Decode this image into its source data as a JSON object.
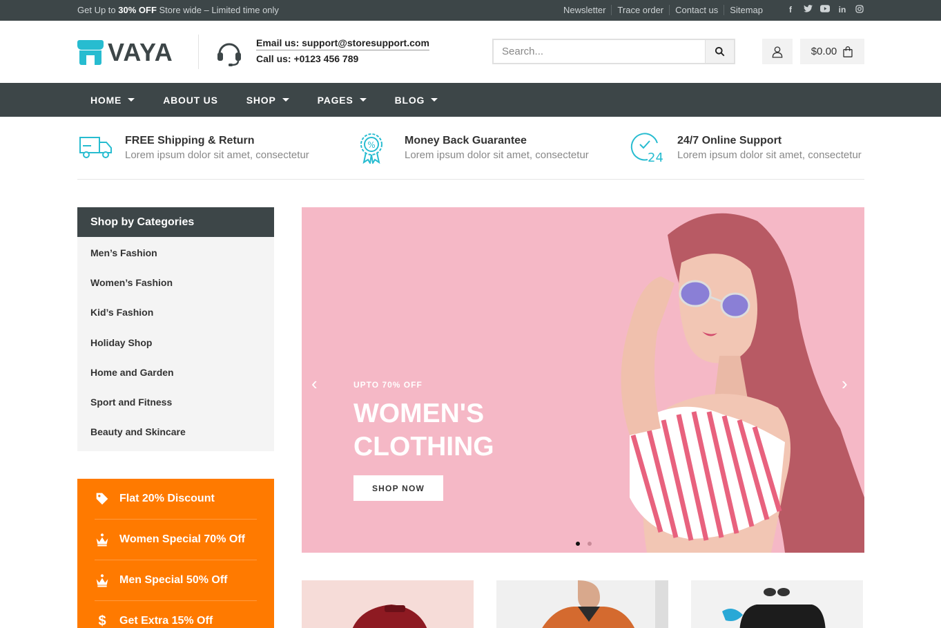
{
  "topbar": {
    "promo_prefix": "Get Up to",
    "promo_bold": "30% OFF",
    "promo_suffix": "Store wide – Limited time only",
    "links": [
      "Newsletter",
      "Trace order",
      "Contact us",
      "Sitemap"
    ],
    "socials": [
      "facebook-icon",
      "twitter-icon",
      "youtube-icon",
      "linkedin-icon",
      "instagram-icon"
    ]
  },
  "header": {
    "logo_text": "VAYA",
    "email": "Email us: support@storesupport.com",
    "call": "Call us: +0123 456 789",
    "search_placeholder": "Search...",
    "cart_total": "$0.00"
  },
  "nav": {
    "items": [
      {
        "label": "HOME",
        "dropdown": true
      },
      {
        "label": "ABOUT US",
        "dropdown": false
      },
      {
        "label": "SHOP",
        "dropdown": true
      },
      {
        "label": "PAGES",
        "dropdown": true
      },
      {
        "label": "BLOG",
        "dropdown": true
      }
    ]
  },
  "features": [
    {
      "icon": "truck-icon",
      "title": "FREE Shipping & Return",
      "desc": "Lorem ipsum dolor sit amet, consectetur"
    },
    {
      "icon": "badge-percent-icon",
      "title": "Money Back Guarantee",
      "desc": "Lorem ipsum dolor sit amet, consectetur"
    },
    {
      "icon": "support-24-icon",
      "title": "24/7 Online Support",
      "desc": "Lorem ipsum dolor sit amet, consectetur"
    }
  ],
  "sidebar": {
    "heading": "Shop by Categories",
    "categories": [
      "Men’s Fashion",
      "Women’s Fashion",
      "Kid’s Fashion",
      "Holiday Shop",
      "Home and Garden",
      "Sport and Fitness",
      "Beauty and Skincare"
    ],
    "offers": [
      {
        "icon": "tag-icon",
        "label": "Flat 20% Discount"
      },
      {
        "icon": "crown-icon",
        "label": "Women Special 70% Off"
      },
      {
        "icon": "crown-icon",
        "label": "Men Special 50% Off"
      },
      {
        "icon": "dollar-icon",
        "label": "Get Extra 15% Off"
      }
    ]
  },
  "banner": {
    "subtitle": "UPTO 70% OFF",
    "title": "WOMEN'S CLOTHING",
    "button": "SHOP NOW",
    "slide_count": 2,
    "active_slide": 1
  },
  "colors": {
    "dark": "#3d4648",
    "accent": "#27bcd0",
    "orange": "#ff7a00",
    "banner_pink": "#f5b8c6"
  }
}
